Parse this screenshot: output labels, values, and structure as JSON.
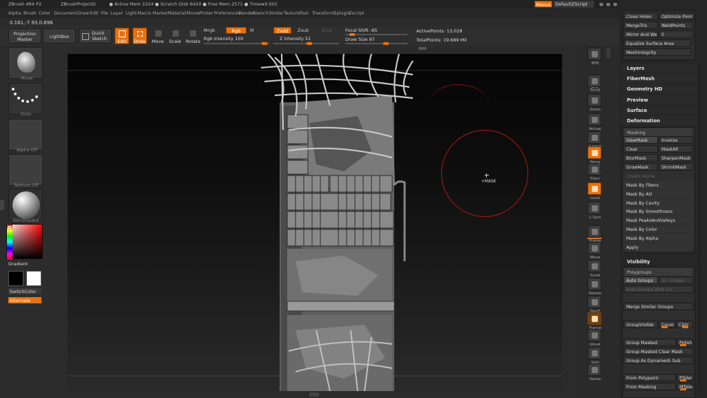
{
  "titlebar": {
    "app": "ZBrush 4R4 P2",
    "project": "ZBrushProjectD",
    "status": "● Active Mem 1524 ● Scratch Disk 6420 ● Free Mem 2571 ● Timer▸0.001",
    "menus_button": "Menus",
    "script_button": "DefaultZScript"
  },
  "menubar": {
    "items": [
      "Alpha",
      "Brush",
      "Color",
      "Document",
      "Draw",
      "Edit",
      "File",
      "Layer",
      "Light",
      "Macro",
      "Marker",
      "Material",
      "Movie",
      "Picker",
      "Preferences",
      "Render",
      "Stencil",
      "Stroke",
      "Texture",
      "Tool",
      "Transform",
      "Zplugin",
      "Zscript"
    ]
  },
  "coords": "0.161,-7.93,0.696",
  "toolbar": {
    "projection_master": "Projection Master",
    "lightbox": "LightBox",
    "quick_sketch": "Quick Sketch",
    "edit": "Edit",
    "draw": "Draw",
    "move": "Move",
    "scale": "Scale",
    "rotate": "Rotate",
    "mrgb": "Mrgb",
    "rgb": "Rgb",
    "m": "M",
    "rgb_intensity": "Rgb Intensity 100",
    "zadd": "Zadd",
    "zsub": "Zsub",
    "zcut": "Zcut",
    "z_intensity": "Z Intensity 51",
    "focal_shift": "Focal Shift -85",
    "draw_size": "Draw Size 97",
    "active_points": "ActivePoints: 13,028",
    "total_points": "TotalPoints: 19.689 Mil"
  },
  "left_shelf": {
    "brush_label": "Move",
    "stroke_label": "Dots",
    "alpha_label": "Alpha Off",
    "texture_label": "Texture Off",
    "material_label": "SkinShade4",
    "gradient": "Gradient",
    "switch_color": "SwitchColor",
    "alternate": "Alternate"
  },
  "canvas": {
    "brush_cursor_label": "+MASK"
  },
  "right_shelf": {
    "tools": [
      "BPR",
      "SPix",
      "Scroll",
      "Zoom",
      "Actual",
      "AAHalf",
      "Persp",
      "Floor",
      "Local",
      "L.Sym",
      "XYZ",
      "Frame",
      "Move",
      "Scale",
      "Rotate",
      "PolyF",
      "Transp",
      "Ghost",
      "Solo",
      "Xpose"
    ]
  },
  "tray": {
    "top_buttons": [
      [
        "Close Holes",
        "Optimize Points"
      ],
      [
        "MergeTris",
        "WeldPoints"
      ],
      [
        "Mirror And Weld",
        "0"
      ],
      [
        "Equalize Surface Area",
        ""
      ],
      [
        "MeshIntegrity",
        ""
      ]
    ],
    "sections": [
      "Layers",
      "FiberMesh",
      "Geometry HD",
      "Preview",
      "Surface",
      "Deformation"
    ],
    "masking_header": "Masking",
    "masking_buttons": [
      [
        "ViewMask",
        "Inverse"
      ],
      [
        "Clear",
        "MaskAll"
      ],
      [
        "BlurMask",
        "SharpenMask"
      ],
      [
        "GrowMask",
        "ShrinkMask"
      ]
    ],
    "create_alpha": "Create Alpha",
    "mask_by": [
      "Mask By Fibers",
      "Mask By AO",
      "Mask By Cavity",
      "Mask By Smoothness",
      "Mask PeaksAndValleys",
      "Mask By Color",
      "Mask By Alpha",
      "Apply"
    ],
    "visibility": "Visibility",
    "polygroups_header": "Polygroups",
    "auto_groups": "Auto Groups",
    "uv_groups": "Uv Groups",
    "auto_groups_with_uv": "Auto Groups With UV",
    "merge_similar": "Merge Similar Groups",
    "group_visible": "GroupVisible",
    "coverage": "Cover",
    "clustering": "Clstr",
    "group_masked": "Group Masked",
    "polish": "Polish",
    "group_masked_clear": "Group Masked Clear Mask",
    "group_as_dynamesh": "Group As Dynamesh Sub",
    "from_polypaint": "From Polypaint",
    "ptolerance": "PToler",
    "from_masking": "From Masking",
    "mtolerance": "MToler"
  },
  "colors": {
    "accent": "#e8720f",
    "panel": "#2b2b2b",
    "cursor_ring": "#b01818"
  }
}
